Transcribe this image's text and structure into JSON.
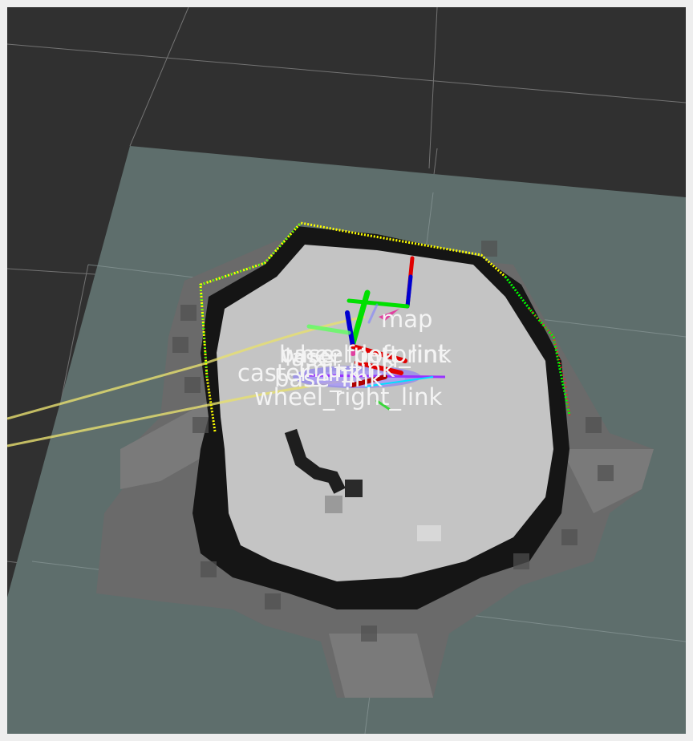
{
  "window": {
    "background": "#303030",
    "border": "#eeeeee"
  },
  "scene": {
    "map_plane_color": "#5e6e6c",
    "grid_color": "#8a8a8a",
    "occupancy": {
      "free": "#c4c4c4",
      "occupied": "#151515",
      "unknown": "#6a6a6a"
    },
    "laser_scan_colors": [
      "#ffff00",
      "#00ff00",
      "#ff2020"
    ],
    "path_color": "#e8e070",
    "axis_colors": {
      "x": "#e00000",
      "y": "#00e000",
      "z": "#0000d0"
    }
  },
  "tf_labels": [
    {
      "id": "map",
      "text": "map"
    },
    {
      "id": "base_footprint",
      "text": "base_footprint"
    },
    {
      "id": "wheel_left_link",
      "text": "wheel_left_link"
    },
    {
      "id": "laser_link",
      "text": "laser_link"
    },
    {
      "id": "caster_link",
      "text": "caster_link"
    },
    {
      "id": "base_link",
      "text": "base_link"
    },
    {
      "id": "imu_link",
      "text": "imu_link"
    },
    {
      "id": "wheel_right_link",
      "text": "wheel_right_link"
    }
  ]
}
